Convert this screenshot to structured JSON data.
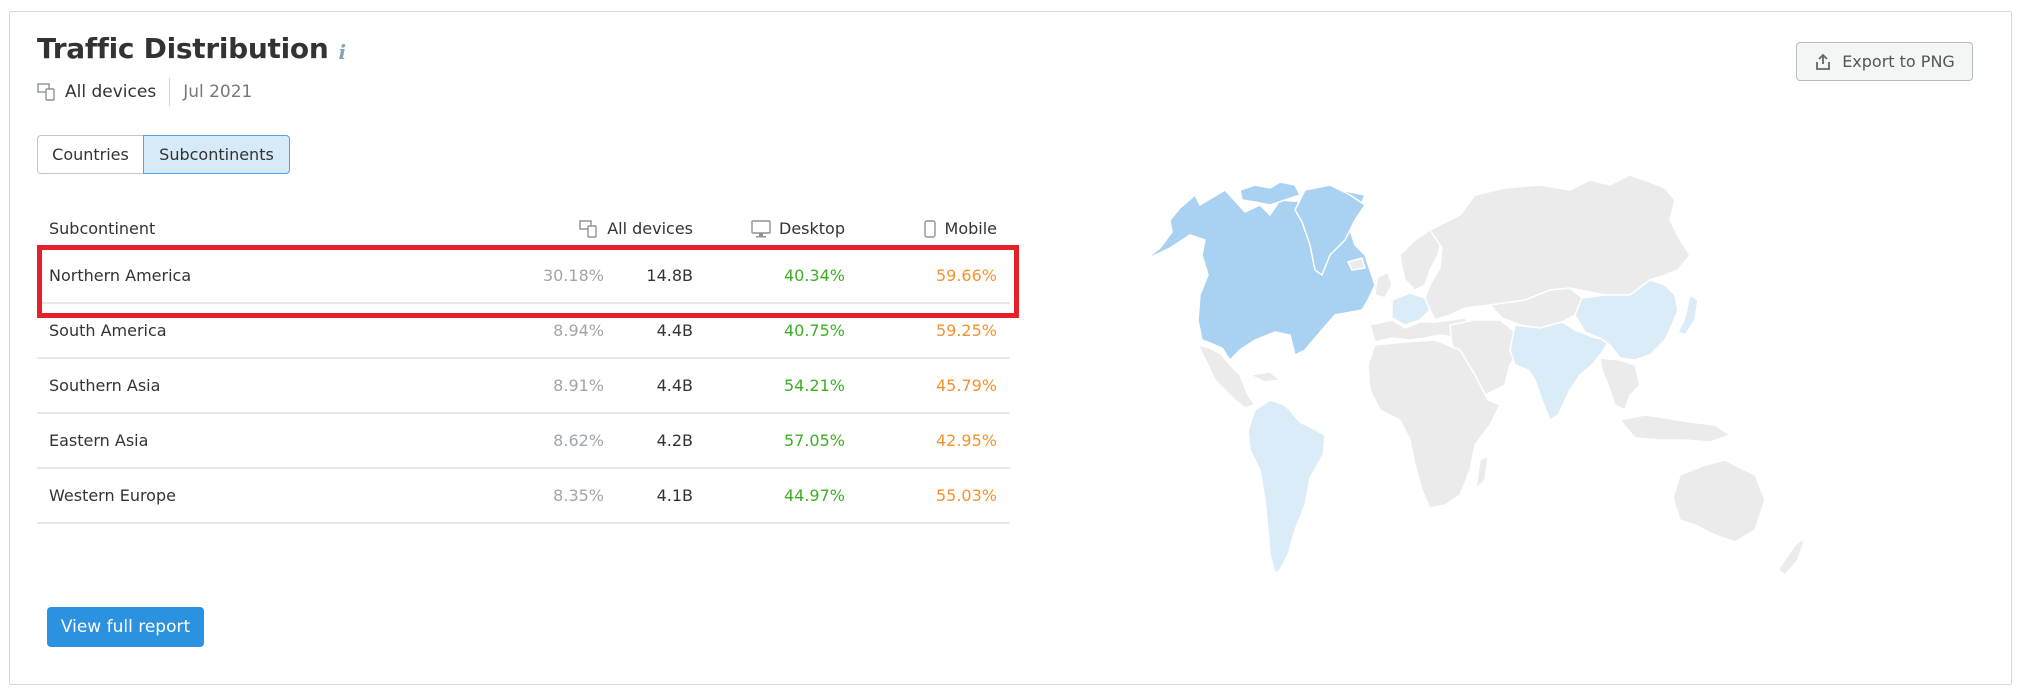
{
  "header": {
    "title": "Traffic Distribution",
    "info_icon": "info-icon",
    "devices_label": "All devices",
    "date": "Jul 2021",
    "export_label": "Export to PNG"
  },
  "tabs": [
    {
      "label": "Countries",
      "active": false
    },
    {
      "label": "Subcontinents",
      "active": true
    }
  ],
  "table": {
    "columns": {
      "name": "Subcontinent",
      "all_devices": "All devices",
      "desktop": "Desktop",
      "mobile": "Mobile"
    },
    "rows": [
      {
        "name": "Northern America",
        "share": "30.18%",
        "traffic": "14.8B",
        "desktop": "40.34%",
        "mobile": "59.66%",
        "highlighted": true
      },
      {
        "name": "South America",
        "share": "8.94%",
        "traffic": "4.4B",
        "desktop": "40.75%",
        "mobile": "59.25%"
      },
      {
        "name": "Southern Asia",
        "share": "8.91%",
        "traffic": "4.4B",
        "desktop": "54.21%",
        "mobile": "45.79%"
      },
      {
        "name": "Eastern Asia",
        "share": "8.62%",
        "traffic": "4.2B",
        "desktop": "57.05%",
        "mobile": "42.95%"
      },
      {
        "name": "Western Europe",
        "share": "8.35%",
        "traffic": "4.1B",
        "desktop": "44.97%",
        "mobile": "55.03%"
      }
    ]
  },
  "footer": {
    "view_full_report_label": "View full report"
  },
  "colors": {
    "desktop": "#3cb023",
    "mobile": "#f6912f",
    "accent": "#2b92e0",
    "highlight_border": "#e52029",
    "map_strong": "#a8d1f2",
    "map_light": "#dbecf9",
    "map_land": "#ebebeb"
  },
  "map": {
    "highlighted_strong": [
      "Northern America"
    ],
    "highlighted_light": [
      "South America",
      "Southern Asia",
      "Eastern Asia",
      "Western Europe"
    ]
  }
}
